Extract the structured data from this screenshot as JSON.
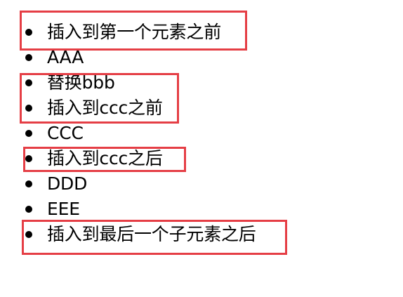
{
  "list": {
    "items": [
      {
        "text": "插入到第一个元素之前",
        "highlighted": true
      },
      {
        "text": "AAA",
        "highlighted": false
      },
      {
        "text": "替换bbb",
        "highlighted": true
      },
      {
        "text": "插入到ccc之前",
        "highlighted": true
      },
      {
        "text": "CCC",
        "highlighted": false
      },
      {
        "text": "插入到ccc之后",
        "highlighted": true
      },
      {
        "text": "DDD",
        "highlighted": false
      },
      {
        "text": "EEE",
        "highlighted": false
      },
      {
        "text": "插入到最后一个子元素之后",
        "highlighted": true
      }
    ]
  },
  "colors": {
    "highlight_border": "#e53e45",
    "text": "#000000",
    "background": "#ffffff"
  }
}
